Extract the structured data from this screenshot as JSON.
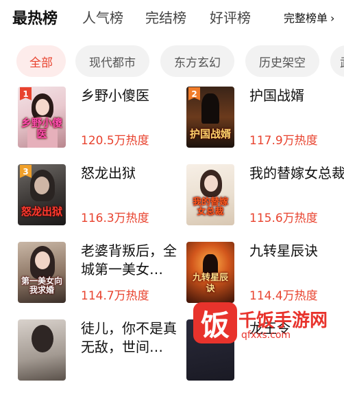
{
  "tabs": [
    {
      "label": "最热榜"
    },
    {
      "label": "人气榜"
    },
    {
      "label": "完结榜"
    },
    {
      "label": "好评榜"
    }
  ],
  "full_list": {
    "label": "完整榜单",
    "icon": "chevron-right-icon"
  },
  "categories": [
    {
      "label": "全部"
    },
    {
      "label": "现代都市"
    },
    {
      "label": "东方玄幻"
    },
    {
      "label": "历史架空"
    },
    {
      "label": "武"
    }
  ],
  "books": [
    {
      "rank": "1",
      "title": "乡野小傻医",
      "heat": "120.5万热度",
      "cover_text": "乡野小傻医"
    },
    {
      "rank": "2",
      "title": "护国战婿",
      "heat": "117.9万热度",
      "cover_text": "护国战婿"
    },
    {
      "rank": "3",
      "title": "怒龙出狱",
      "heat": "116.3万热度",
      "cover_text": "怒龙出狱"
    },
    {
      "rank": "",
      "title": "我的替嫁女总裁",
      "heat": "115.6万热度",
      "cover_text": "我的替嫁女总裁"
    },
    {
      "rank": "",
      "title": "老婆背叛后，全城第一美女…",
      "heat": "114.7万热度",
      "cover_text": "第一美女向我求婚"
    },
    {
      "rank": "",
      "title": "九转星辰诀",
      "heat": "114.4万热度",
      "cover_text": "九转星辰诀"
    },
    {
      "rank": "",
      "title": "徒儿，你不是真无敌，世间…",
      "heat": "",
      "cover_text": ""
    },
    {
      "rank": "",
      "title": "龙王令",
      "heat": "",
      "cover_text": ""
    }
  ],
  "watermark": {
    "logo": "饭",
    "name": "千饭手游网",
    "url": "qfxxs.com"
  },
  "colors": {
    "accent": "#e8432f",
    "chip_bg": "#f2f2f2",
    "chip_active_bg": "#fdeceb",
    "rank1": "#e8432f",
    "rank2": "#f07c2a",
    "rank3": "#f0a02a"
  }
}
